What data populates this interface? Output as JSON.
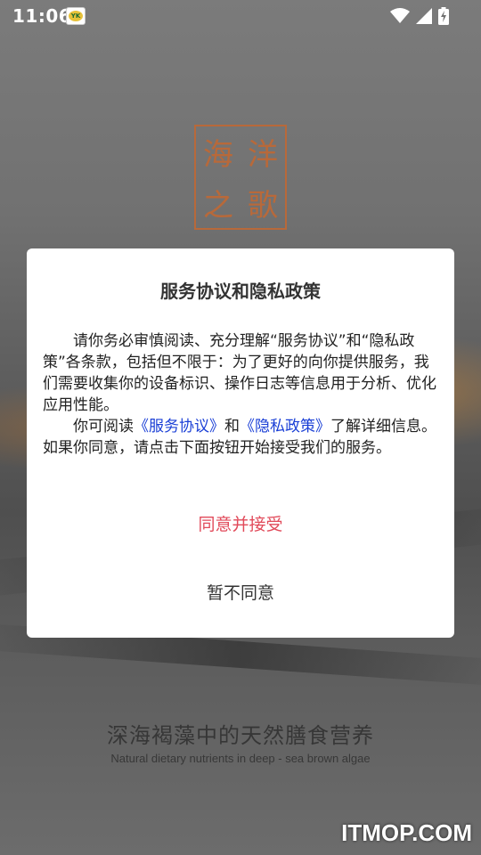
{
  "status_bar": {
    "time": "11:06",
    "app_icon_text": "YK"
  },
  "logo": {
    "chars": [
      "海",
      "洋",
      "之",
      "歌"
    ]
  },
  "dialog": {
    "title": "服务协议和隐私政策",
    "para1": "请你务必审慎阅读、充分理解“服务协议”和“隐私政策”各条款，包括但不限于：为了更好的向你提供服务，我们需要收集你的设备标识、操作日志等信息用于分析、优化应用性能。",
    "para2_prefix": "你可阅读",
    "service_link": "《服务协议》",
    "para2_and": "和",
    "privacy_link": "《隐私政策》",
    "para2_suffix": "了解详细信息。如果你同意，请点击下面按钮开始接受我们的服务。",
    "agree_label": "同意并接受",
    "decline_label": "暂不同意"
  },
  "background": {
    "slogan_cn": "深海褐藻中的天然膳食营养",
    "slogan_en": "Natural dietary nutrients in deep - sea brown algae"
  },
  "watermark": "ITMOP.COM",
  "colors": {
    "agree": "#e14a5a",
    "link": "#1a3fd6",
    "logo": "#b8693a"
  }
}
